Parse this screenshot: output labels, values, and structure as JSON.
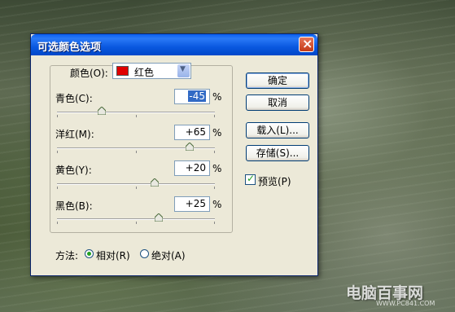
{
  "window": {
    "title": "可选颜色选项"
  },
  "colors": {
    "label": "颜色(O):",
    "selected": "红色",
    "swatch_color": "#e00000"
  },
  "adjustments": [
    {
      "label": "青色(C):",
      "value": "-45",
      "unit": "%",
      "selected": true
    },
    {
      "label": "洋红(M):",
      "value": "+65",
      "unit": "%"
    },
    {
      "label": "黄色(Y):",
      "value": "+20",
      "unit": "%"
    },
    {
      "label": "黑色(B):",
      "value": "+25",
      "unit": "%"
    }
  ],
  "method": {
    "label": "方法:",
    "options": [
      {
        "label": "相对(R)",
        "checked": true
      },
      {
        "label": "绝对(A)",
        "checked": false
      }
    ]
  },
  "buttons": {
    "ok": "确定",
    "cancel": "取消",
    "load": "载入(L)...",
    "save": "存储(S)..."
  },
  "preview": {
    "label": "预览(P)",
    "checked": true
  },
  "watermark": {
    "text": "电脑百事网",
    "url": "WWW.PC841.COM"
  }
}
